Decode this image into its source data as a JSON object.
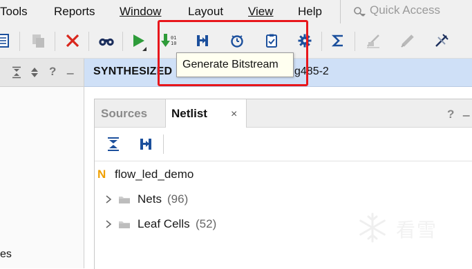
{
  "menu": {
    "items": [
      {
        "label": "Tools"
      },
      {
        "label": "Reports"
      },
      {
        "label": "Window"
      },
      {
        "label": "Layout"
      },
      {
        "label": "View"
      },
      {
        "label": "Help"
      }
    ]
  },
  "quick_access": {
    "placeholder": "Quick Access"
  },
  "toolbar": {
    "icons": [
      "report-icon",
      "copy-icon",
      "delete-icon",
      "binoculars-icon",
      "run-icon",
      "generate-bitstream-icon",
      "schematic-icon",
      "timer-icon",
      "clipboard-check-icon",
      "gear-icon",
      "sigma-icon",
      "disabled-tool-icon",
      "disabled-probe-icon",
      "disabled-debug-icon"
    ],
    "tooltip": "Generate Bitstream"
  },
  "banner": {
    "title": "SYNTHESIZED",
    "part_suffix": "g485-2"
  },
  "left_panel": {
    "truncated_label": "es"
  },
  "tabs": [
    {
      "label": "Sources"
    },
    {
      "label": "Netlist",
      "close": "×"
    }
  ],
  "panel_controls": {
    "help": "?",
    "minimize": "_"
  },
  "netlist": {
    "root_badge": "N",
    "root": "flow_led_demo",
    "items": [
      {
        "label": "Nets",
        "count": "(96)"
      },
      {
        "label": "Leaf Cells",
        "count": "(52)"
      }
    ]
  },
  "watermark": {
    "text": "看雪"
  },
  "colors": {
    "highlight": "#e8161b",
    "banner_bg": "#cfe0f7",
    "accent_blue": "#1b4f9c",
    "run_green": "#2e9c3a",
    "delete_red": "#d9261c",
    "badge_orange": "#f0a000"
  }
}
